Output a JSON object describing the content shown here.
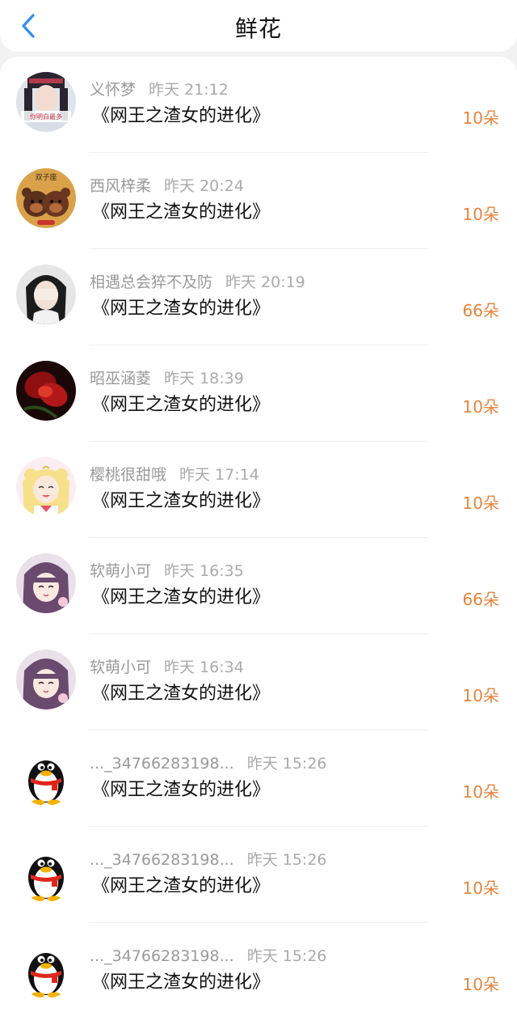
{
  "header": {
    "title": "鲜花",
    "back_icon": "chevron-left-icon",
    "accent": "#2f8ff0"
  },
  "list": {
    "count_color": "#e8843d",
    "items": [
      {
        "name": "义怀梦",
        "time": "昨天 21:12",
        "book": "《网王之渣女的进化》",
        "count": "10朵",
        "avatar": "portrait-avatar",
        "avatar_text": "你明白最多"
      },
      {
        "name": "西风梓柔",
        "time": "昨天 20:24",
        "book": "《网王之渣女的进化》",
        "count": "10朵",
        "avatar": "twins-bear-avatar",
        "avatar_text": "双子座"
      },
      {
        "name": "相遇总会猝不及防",
        "time": "昨天 20:19",
        "book": "《网王之渣女的进化》",
        "count": "66朵",
        "avatar": "girl-covering-face-avatar"
      },
      {
        "name": "昭巫涵菱",
        "time": "昨天 18:39",
        "book": "《网王之渣女的进化》",
        "count": "10朵",
        "avatar": "red-flower-avatar"
      },
      {
        "name": "樱桃很甜哦",
        "time": "昨天 17:14",
        "book": "《网王之渣女的进化》",
        "count": "10朵",
        "avatar": "sailor-moon-avatar"
      },
      {
        "name": "软萌小可",
        "time": "昨天 16:35",
        "book": "《网王之渣女的进化》",
        "count": "66朵",
        "avatar": "anime-girl-avatar"
      },
      {
        "name": "软萌小可",
        "time": "昨天 16:34",
        "book": "《网王之渣女的进化》",
        "count": "10朵",
        "avatar": "anime-girl-avatar"
      },
      {
        "name": "..._34766283198...",
        "time": "昨天 15:26",
        "book": "《网王之渣女的进化》",
        "count": "10朵",
        "avatar": "qq-penguin-avatar"
      },
      {
        "name": "..._34766283198...",
        "time": "昨天 15:26",
        "book": "《网王之渣女的进化》",
        "count": "10朵",
        "avatar": "qq-penguin-avatar"
      },
      {
        "name": "..._34766283198...",
        "time": "昨天 15:26",
        "book": "《网王之渣女的进化》",
        "count": "10朵",
        "avatar": "qq-penguin-avatar"
      }
    ]
  }
}
